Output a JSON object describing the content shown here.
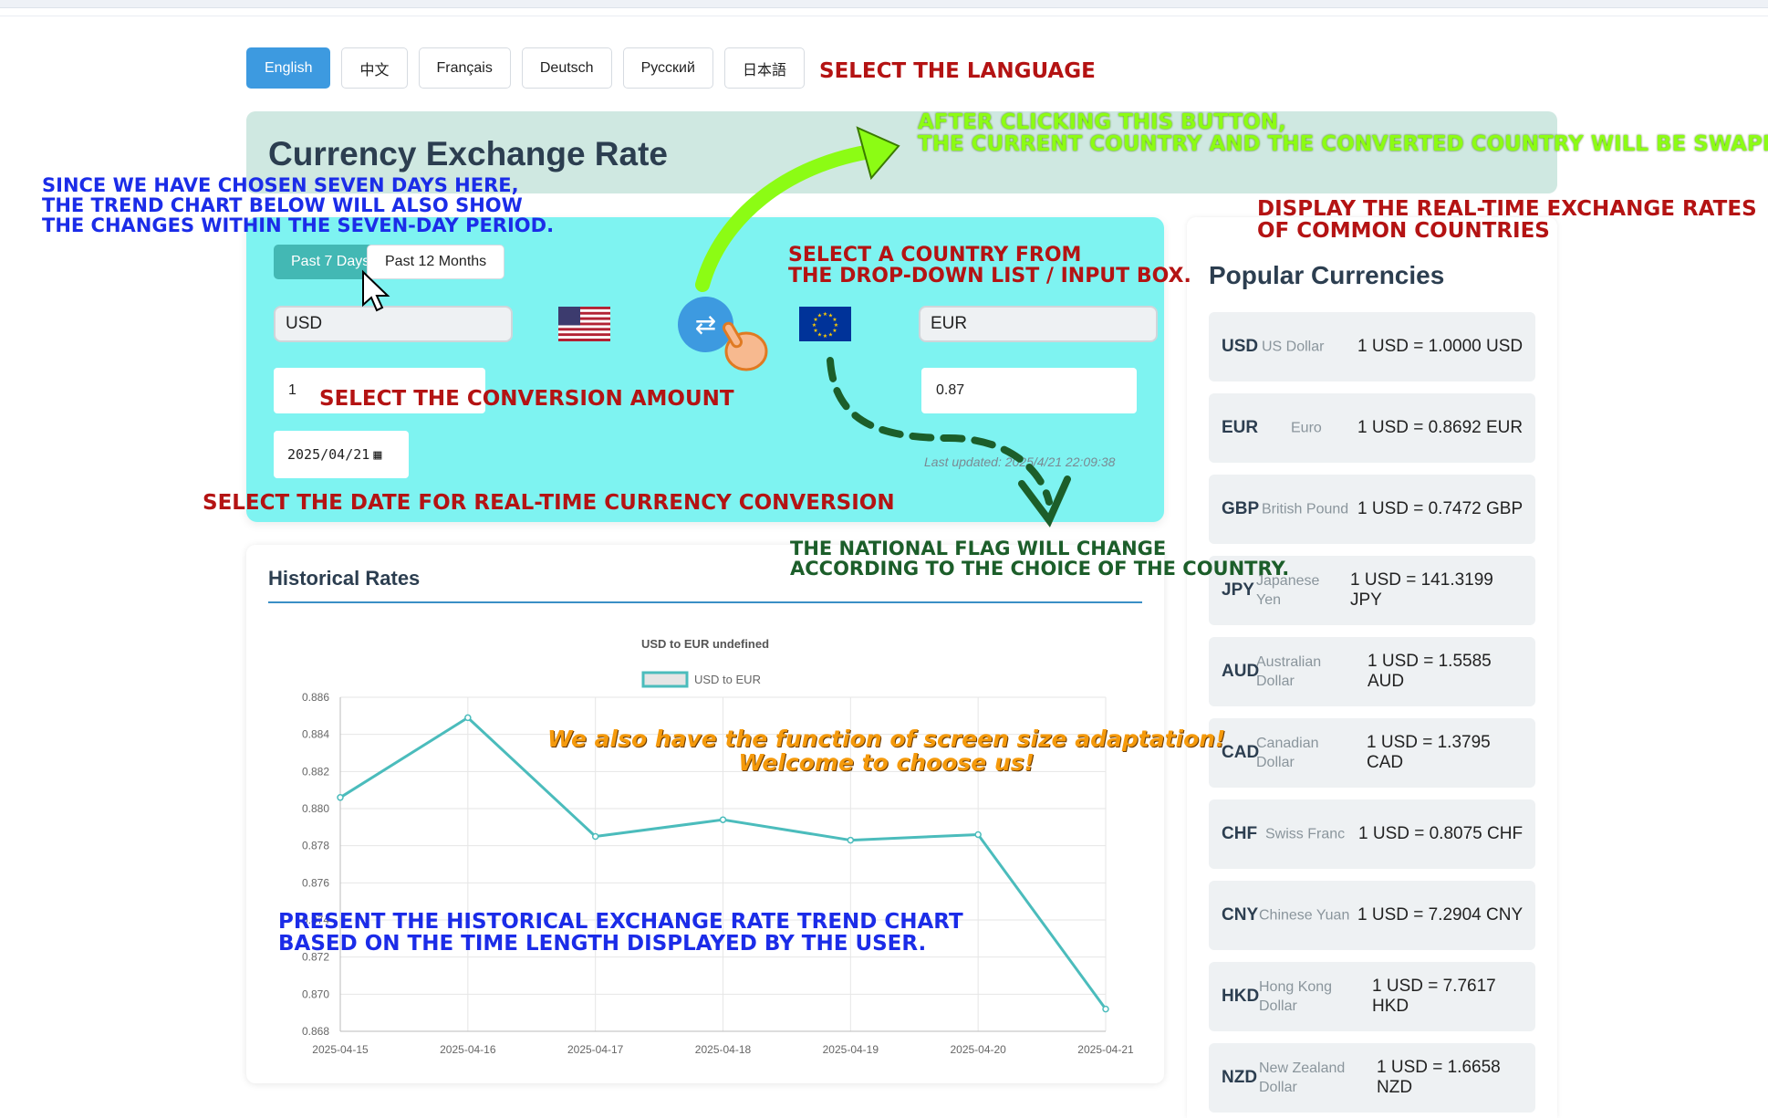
{
  "languages": [
    {
      "label": "English",
      "active": true
    },
    {
      "label": "中文",
      "active": false
    },
    {
      "label": "Français",
      "active": false
    },
    {
      "label": "Deutsch",
      "active": false
    },
    {
      "label": "Русский",
      "active": false
    },
    {
      "label": "日本語",
      "active": false
    }
  ],
  "header": {
    "title": "Currency Exchange Rate"
  },
  "converter": {
    "period_7": "Past 7 Days",
    "period_12": "Past 12 Months",
    "from_currency": "USD",
    "to_currency": "EUR",
    "amount": "1",
    "converted": "0.87",
    "date": "2025/04/21",
    "last_updated": "Last updated: 2025/4/21 22:09:38",
    "swap_icon": "swap-arrows-icon",
    "from_flag": "us-flag-icon",
    "to_flag": "eu-flag-icon",
    "accent_color": "#3d9ae0",
    "panel_color": "#7ef3f1"
  },
  "history": {
    "title": "Historical Rates"
  },
  "chart_data": {
    "type": "line",
    "title": "USD to EUR undefined",
    "x": [
      "2025-04-15",
      "2025-04-16",
      "2025-04-17",
      "2025-04-18",
      "2025-04-19",
      "2025-04-20",
      "2025-04-21"
    ],
    "series": [
      {
        "name": "USD to EUR",
        "values": [
          0.8806,
          0.8849,
          0.8785,
          0.8794,
          0.8783,
          0.8786,
          0.8692
        ]
      }
    ],
    "yticks": [
      "0.886",
      "0.884",
      "0.882",
      "0.880",
      "0.878",
      "0.876",
      "0.874",
      "0.872",
      "0.870",
      "0.868"
    ],
    "ylim": [
      0.868,
      0.886
    ],
    "grid": true,
    "legend": "top-center",
    "line_color": "#4bbcbc"
  },
  "popular": {
    "title": "Popular Currencies",
    "items": [
      {
        "code": "USD",
        "name": "US Dollar",
        "rate1": "1 USD = 1.0000 USD",
        "rate2": ""
      },
      {
        "code": "EUR",
        "name": "Euro",
        "rate1": "1 USD = 0.8692 EUR",
        "rate2": ""
      },
      {
        "code": "GBP",
        "name": "British Pound",
        "rate1": "1 USD = 0.7472 GBP",
        "rate2": ""
      },
      {
        "code": "JPY",
        "name": "Japanese Yen",
        "rate1": "1 USD = 141.3199",
        "rate2": "JPY"
      },
      {
        "code": "AUD",
        "name": "Australian Dollar",
        "rate1": "1 USD = 1.5585",
        "rate2": "AUD"
      },
      {
        "code": "CAD",
        "name": "Canadian Dollar",
        "rate1": "1 USD = 1.3795",
        "rate2": "CAD"
      },
      {
        "code": "CHF",
        "name": "Swiss Franc",
        "rate1": "1 USD = 0.8075 CHF",
        "rate2": ""
      },
      {
        "code": "CNY",
        "name": "Chinese Yuan",
        "rate1": "1 USD = 7.2904 CNY",
        "rate2": ""
      },
      {
        "code": "HKD",
        "name": "Hong Kong Dollar",
        "rate1": "1 USD = 7.7617",
        "rate2": "HKD"
      },
      {
        "code": "NZD",
        "name": "New Zealand Dollar",
        "rate1": "1 USD = 1.6658",
        "rate2": "NZD"
      }
    ]
  },
  "annotations": {
    "select_language": "SELECT THE LANGUAGE",
    "swap_note": "AFTER CLICKING THIS BUTTON,\nTHE CURRENT COUNTRY AND THE CONVERTED COUNTRY WILL BE SWAPPED.",
    "seven_days_note": "SINCE WE HAVE CHOSEN SEVEN DAYS HERE,\nTHE TREND CHART BELOW WILL ALSO SHOW\nTHE CHANGES WITHIN THE SEVEN-DAY PERIOD.",
    "realtime_note": "DISPLAY THE REAL-TIME EXCHANGE RATES\nOF COMMON COUNTRIES",
    "select_country": "SELECT A COUNTRY FROM\nTHE DROP-DOWN LIST / INPUT BOX.",
    "conversion_amount": "SELECT THE CONVERSION AMOUNT",
    "select_date": "SELECT THE DATE FOR REAL-TIME CURRENCY CONVERSION",
    "flag_note": "THE NATIONAL FLAG WILL CHANGE\nACCORDING TO THE CHOICE OF THE COUNTRY.",
    "adaptation_note": "We also have the function of screen size adaptation!\nWelcome to choose us!",
    "trend_note": "PRESENT THE HISTORICAL EXCHANGE RATE TREND CHART\nBASED ON THE TIME LENGTH DISPLAYED BY THE USER."
  }
}
